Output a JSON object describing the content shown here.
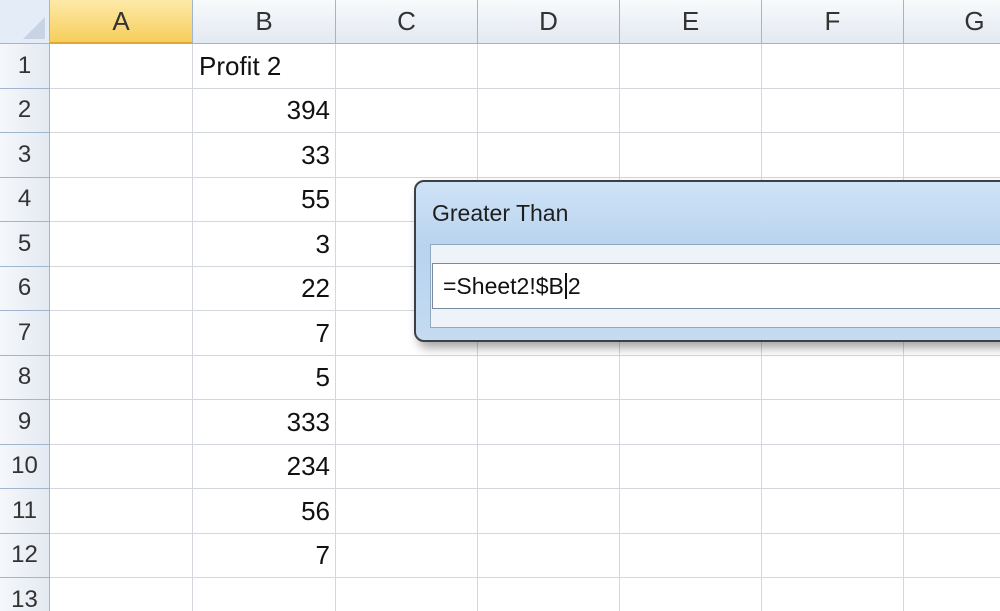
{
  "columns": [
    "A",
    "B",
    "C",
    "D",
    "E",
    "F",
    "G"
  ],
  "rows": [
    "1",
    "2",
    "3",
    "4",
    "5",
    "6",
    "7",
    "8",
    "9",
    "10",
    "11",
    "12",
    "13"
  ],
  "active_column": "A",
  "column_b": {
    "header": "Profit 2",
    "values": [
      "394",
      "33",
      "55",
      "3",
      "22",
      "7",
      "5",
      "333",
      "234",
      "56",
      "7"
    ]
  },
  "dialog": {
    "title": "Greater Than",
    "input_before_caret": "=Sheet2!$B",
    "input_after_caret": "2"
  }
}
